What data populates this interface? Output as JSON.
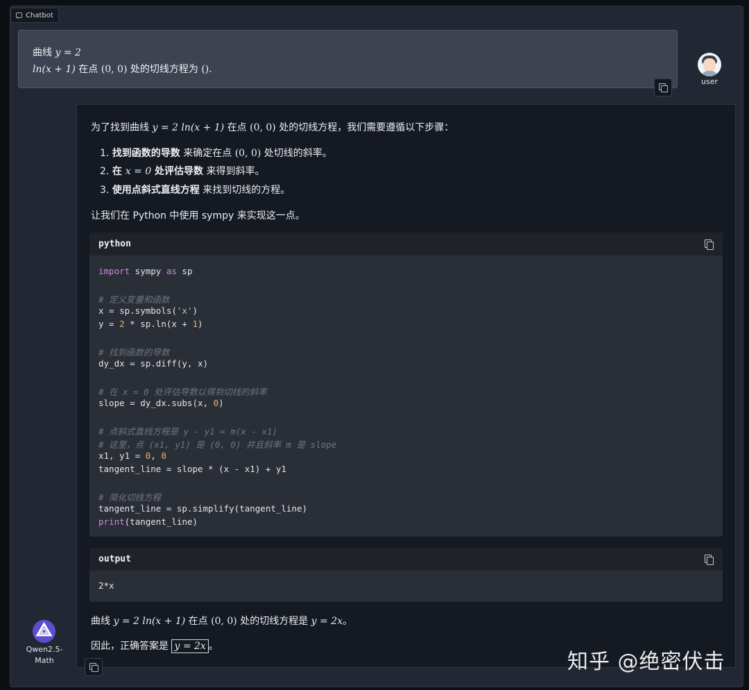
{
  "header": {
    "label": "Chatbot"
  },
  "user": {
    "name": "user",
    "msg_line1_prefix": "曲线 ",
    "msg_line1_math": "y = 2",
    "msg_line2_math": "ln(x + 1)",
    "msg_line2_mid": " 在点 ",
    "msg_line2_point": "(0, 0)",
    "msg_line2_suffix": " 处的切线方程为 ",
    "msg_line2_paren": "()",
    "msg_line2_end": "."
  },
  "bot": {
    "name_line1": "Qwen2.5-",
    "name_line2": "Math",
    "intro_a": "为了找到曲线 ",
    "intro_math": "y = 2 ln(x + 1)",
    "intro_b": " 在点 ",
    "intro_point": "(0, 0)",
    "intro_c": " 处的切线方程，我们需要遵循以下步骤：",
    "steps": [
      {
        "num": "1. ",
        "bold": "找到函数的导数",
        "rest_a": " 来确定在点 ",
        "math": "(0, 0)",
        "rest_b": " 处切线的斜率。"
      },
      {
        "num": "2. ",
        "bold_a": "在 ",
        "math": "x = 0",
        "bold_b": " 处评估导数",
        "rest": " 来得到斜率。"
      },
      {
        "num": "3. ",
        "bold": "使用点斜式直线方程",
        "rest": " 来找到切线的方程。"
      }
    ],
    "python_note": "让我们在 Python 中使用 sympy 来实现这一点。",
    "code_lang": "python",
    "code": {
      "l1_kw": "import",
      "l1_a": " sympy ",
      "l1_as": "as",
      "l1_b": " sp",
      "c1": "# 定义变量和函数",
      "l2_a": "x = sp.symbols(",
      "l2_str": "'x'",
      "l2_b": ")",
      "l3_a": "y = ",
      "l3_num": "2",
      "l3_b": " * sp.ln(x + ",
      "l3_num2": "1",
      "l3_c": ")",
      "c2": "# 找到函数的导数",
      "l4": "dy_dx = sp.diff(y, x)",
      "c3": "# 在 x = 0 处评估导数以得到切线的斜率",
      "l5_a": "slope = dy_dx.subs(x, ",
      "l5_num": "0",
      "l5_b": ")",
      "c4": "# 点斜式直线方程是 y - y1 = m(x - x1)",
      "c5": "# 这里，点 (x1, y1) 是 (0, 0) 并且斜率 m 是 slope",
      "l6_a": "x1, y1 = ",
      "l6_num": "0",
      "l6_b": ", ",
      "l6_num2": "0",
      "l7": "tangent_line = slope * (x - x1) + y1",
      "c6": "# 简化切线方程",
      "l8": "tangent_line = sp.simplify(tangent_line)",
      "l9_kw": "print",
      "l9_b": "(tangent_line)"
    },
    "output_label": "output",
    "output_value": "2*x",
    "result_a": "曲线 ",
    "result_math": "y = 2 ln(x + 1)",
    "result_b": " 在点 ",
    "result_point": "(0, 0)",
    "result_c": " 处的切线方程是 ",
    "result_eq": "y = 2x",
    "result_d": "。",
    "answer_a": "因此，正确答案是 ",
    "answer_box": "y = 2x",
    "answer_b": "。"
  },
  "watermark": "知乎 @绝密伏击",
  "colors": {
    "background": "#222833",
    "user_bubble": "#3d4350",
    "bot_bubble": "#141922",
    "code_bg": "#2a2e36"
  }
}
